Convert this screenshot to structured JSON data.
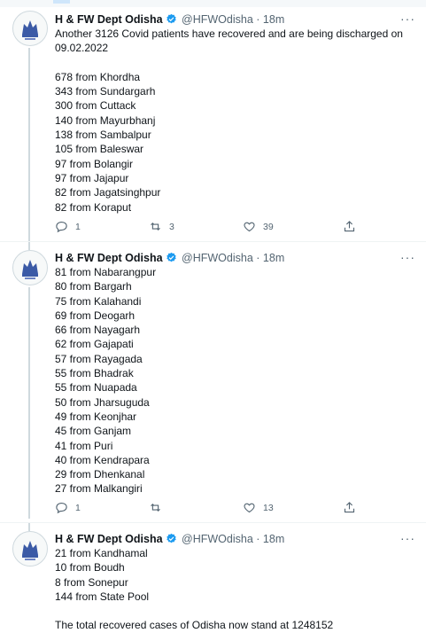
{
  "tweets": [
    {
      "name": "H & FW Dept Odisha",
      "handle": "@HFWOdisha",
      "dot": "·",
      "time": "18m",
      "more": "···",
      "lines": [
        "Another 3126 Covid patients have recovered and are being discharged on",
        "09.02.2022",
        "",
        "678 from Khordha",
        "343 from Sundargarh",
        "300 from Cuttack",
        "140 from Mayurbhanj",
        "138 from Sambalpur",
        "105 from Baleswar",
        "97 from Bolangir",
        "97 from Jajapur",
        "82 from Jagatsinghpur",
        "82 from Koraput"
      ],
      "replies": "1",
      "retweets": "3",
      "likes": "39"
    },
    {
      "name": "H & FW Dept Odisha",
      "handle": "@HFWOdisha",
      "dot": "·",
      "time": "18m",
      "more": "···",
      "lines": [
        "81 from Nabarangpur",
        "80 from Bargarh",
        "75 from Kalahandi",
        "69 from Deogarh",
        "66 from Nayagarh",
        "62 from Gajapati",
        "57 from Rayagada",
        "55 from Bhadrak",
        "55 from Nuapada",
        "50 from Jharsuguda",
        "49 from Keonjhar",
        "45 from Ganjam",
        "41 from Puri",
        "40 from Kendrapara",
        "29 from Dhenkanal",
        "27 from Malkangiri"
      ],
      "replies": "1",
      "retweets": "",
      "likes": "13"
    },
    {
      "name": "H & FW Dept Odisha",
      "handle": "@HFWOdisha",
      "dot": "·",
      "time": "18m",
      "more": "···",
      "lines": [
        "21 from Kandhamal",
        "10 from Boudh",
        "8 from Sonepur",
        "144 from State Pool",
        "",
        "The total recovered cases of Odisha now stand at 1248152"
      ]
    }
  ],
  "icons": {
    "reply": "reply-icon",
    "retweet": "retweet-icon",
    "like": "like-icon",
    "share": "share-icon",
    "verified": "verified-badge-icon",
    "more": "more-options-icon"
  },
  "colors": {
    "verified": "#1d9bf0",
    "secondary_text": "#536471",
    "thread_line": "#cfd9de"
  }
}
